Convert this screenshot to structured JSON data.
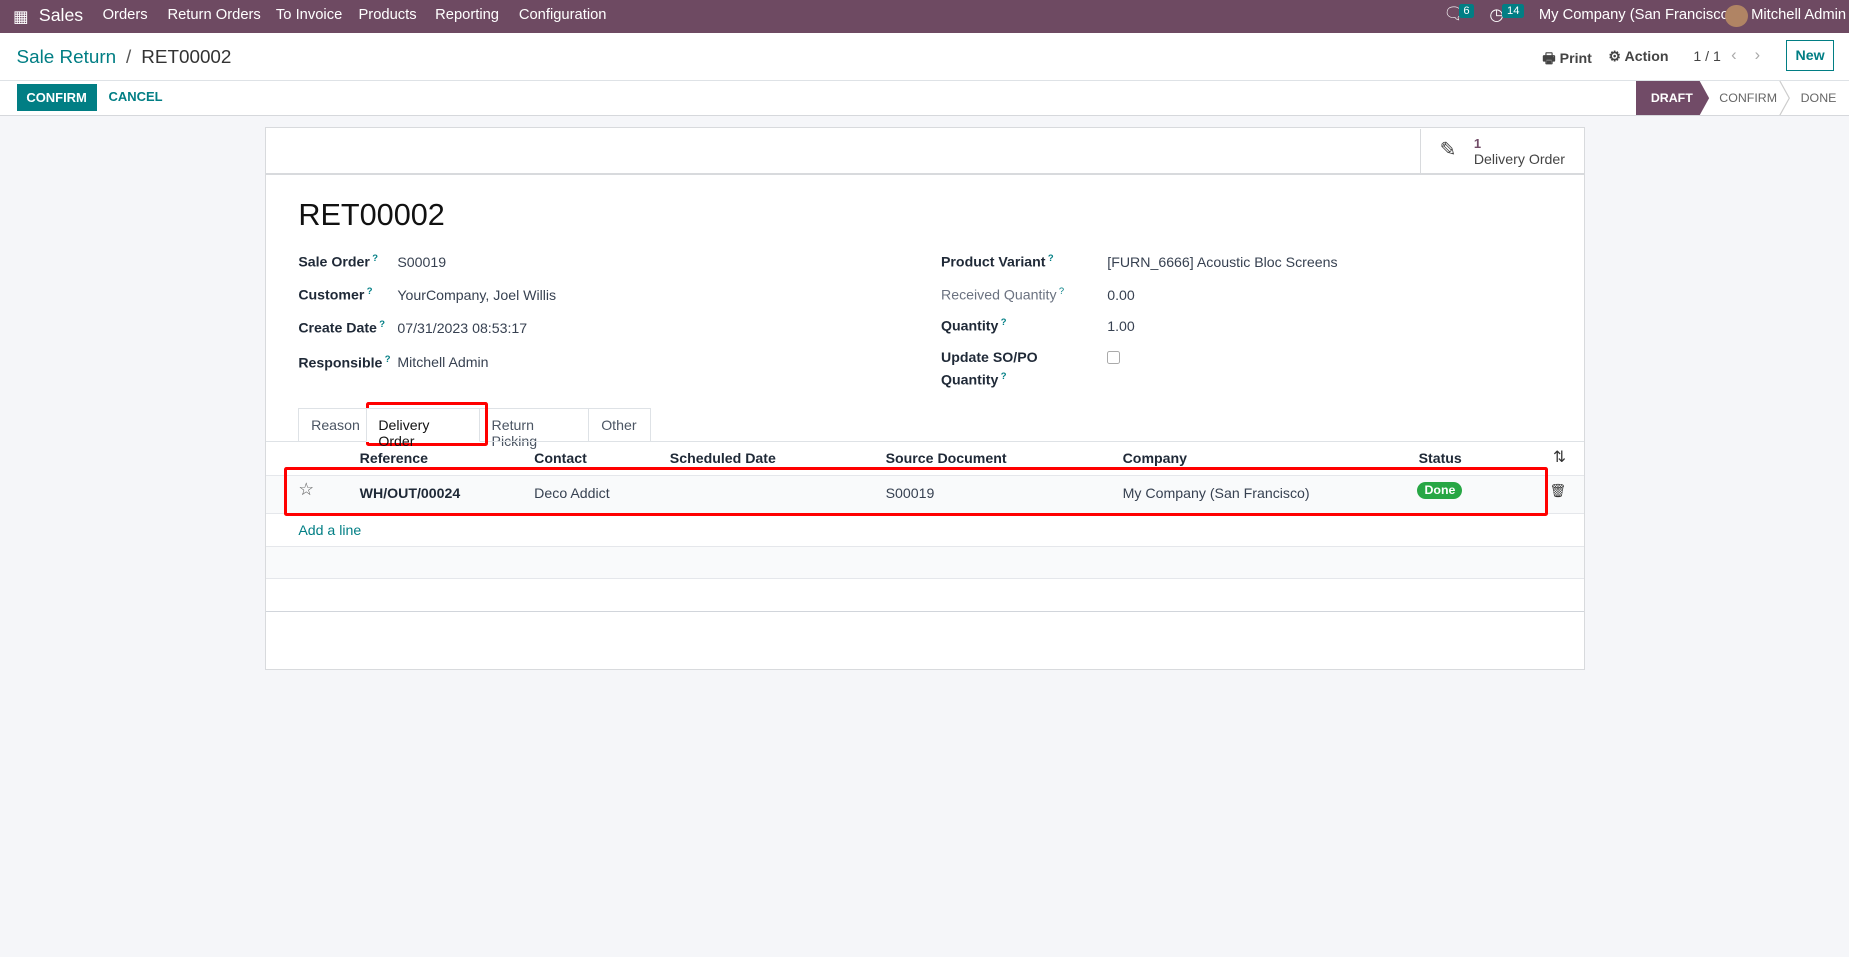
{
  "nav": {
    "app": "Sales",
    "menu": [
      "Orders",
      "Return Orders",
      "To Invoice",
      "Products",
      "Reporting",
      "Configuration"
    ],
    "messages_count": "6",
    "activities_count": "14",
    "company": "My Company (San Francisco)",
    "user": "Mitchell Admin"
  },
  "breadcrumb": {
    "parent": "Sale Return",
    "sep": "/",
    "current": "RET00002"
  },
  "toolbar": {
    "print": "Print",
    "action": "Action",
    "pager": "1 / 1",
    "new": "New"
  },
  "actions": {
    "confirm": "CONFIRM",
    "cancel": "CANCEL"
  },
  "statusbar": {
    "stages": [
      "DRAFT",
      "CONFIRM",
      "DONE"
    ],
    "active": "DRAFT"
  },
  "smart_button": {
    "count": "1",
    "label": "Delivery Order"
  },
  "record": {
    "name": "RET00002",
    "left": [
      {
        "label": "Sale Order",
        "value": "S00019"
      },
      {
        "label": "Customer",
        "value": "YourCompany, Joel Willis"
      },
      {
        "label": "Create Date",
        "value": "07/31/2023 08:53:17"
      },
      {
        "label": "Responsible",
        "value": "Mitchell Admin"
      }
    ],
    "right": [
      {
        "label": "Product Variant",
        "value": "[FURN_6666] Acoustic Bloc Screens"
      },
      {
        "label": "Received Quantity",
        "value": "0.00"
      },
      {
        "label": "Quantity",
        "value": "1.00"
      },
      {
        "label": "Update SO/PO",
        "label2": "Quantity",
        "value": ""
      }
    ],
    "q": "?"
  },
  "tabs": [
    "Reason",
    "Delivery Order",
    "Return Picking",
    "Other"
  ],
  "table": {
    "columns": [
      "Reference",
      "Contact",
      "Scheduled Date",
      "Source Document",
      "Company",
      "Status"
    ],
    "rows": [
      {
        "reference": "WH/OUT/00024",
        "contact": "Deco Addict",
        "scheduled_date": "",
        "source": "S00019",
        "company": "My Company (San Francisco)",
        "status": "Done"
      }
    ],
    "add_line": "Add a line"
  },
  "colors": {
    "brand": "#6e4a62",
    "accent": "#017e84",
    "done": "#28a745"
  }
}
